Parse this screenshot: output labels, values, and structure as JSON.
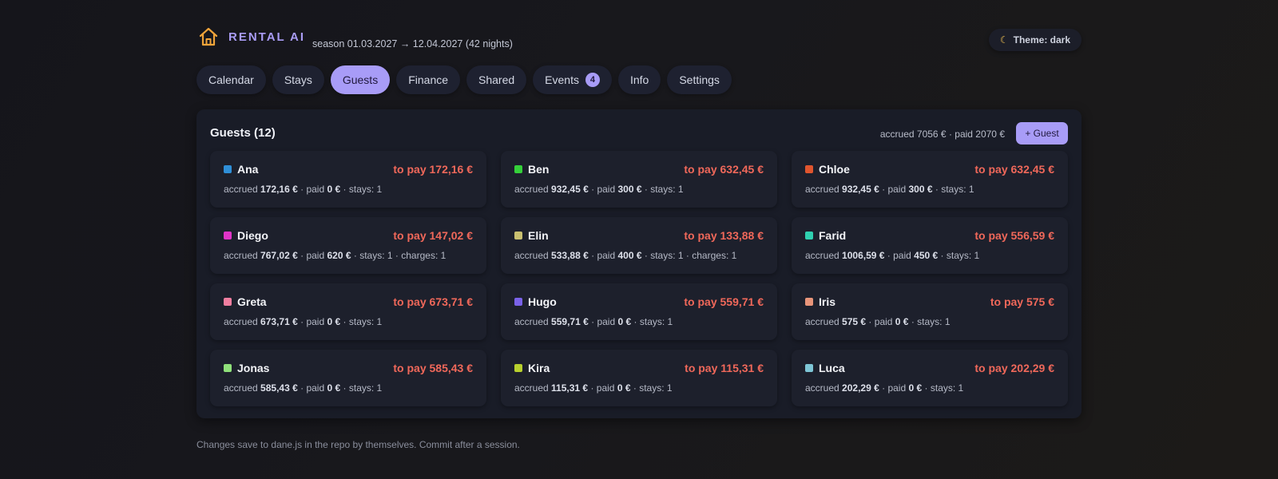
{
  "app": {
    "title": "RENTAL AI",
    "logo_icon": "home-icon",
    "accent_color": "#a89cf7",
    "season": "season 01.03.2027 → 12.04.2027 (42 nights)",
    "theme_label": "Theme: dark",
    "theme_icon": "moon-icon"
  },
  "tabs": [
    {
      "label": "Calendar"
    },
    {
      "label": "Stays"
    },
    {
      "label": "Guests",
      "active": true
    },
    {
      "label": "Finance"
    },
    {
      "label": "Shared"
    },
    {
      "label": "Events",
      "badge": "4"
    },
    {
      "label": "Info"
    },
    {
      "label": "Settings"
    }
  ],
  "guests_panel": {
    "title": "Guests (12)",
    "summary": "accrued 7056 € · paid 2070 €",
    "add_button_label": "+ Guest",
    "to_pay_color": "#f0685a",
    "guests": [
      {
        "name": "Ana",
        "color": "#2f8fd8",
        "to_pay": "to pay 172,16 €",
        "accrued": "172,16 €",
        "paid": "0 €",
        "stays": "stays: 1",
        "charges": ""
      },
      {
        "name": "Ben",
        "color": "#35d03a",
        "to_pay": "to pay 632,45 €",
        "accrued": "932,45 €",
        "paid": "300 €",
        "stays": "stays: 1",
        "charges": ""
      },
      {
        "name": "Chloe",
        "color": "#e0552e",
        "to_pay": "to pay 632,45 €",
        "accrued": "932,45 €",
        "paid": "300 €",
        "stays": "stays: 1",
        "charges": ""
      },
      {
        "name": "Diego",
        "color": "#e034c8",
        "to_pay": "to pay 147,02 €",
        "accrued": "767,02 €",
        "paid": "620 €",
        "stays": "stays: 1",
        "charges": "charges: 1"
      },
      {
        "name": "Elin",
        "color": "#c9c070",
        "to_pay": "to pay 133,88 €",
        "accrued": "533,88 €",
        "paid": "400 €",
        "stays": "stays: 1",
        "charges": "charges: 1"
      },
      {
        "name": "Farid",
        "color": "#2fd0b0",
        "to_pay": "to pay 556,59 €",
        "accrued": "1006,59 €",
        "paid": "450 €",
        "stays": "stays: 1",
        "charges": ""
      },
      {
        "name": "Greta",
        "color": "#f07ea0",
        "to_pay": "to pay 673,71 €",
        "accrued": "673,71 €",
        "paid": "0 €",
        "stays": "stays: 1",
        "charges": ""
      },
      {
        "name": "Hugo",
        "color": "#7a62e8",
        "to_pay": "to pay 559,71 €",
        "accrued": "559,71 €",
        "paid": "0 €",
        "stays": "stays: 1",
        "charges": ""
      },
      {
        "name": "Iris",
        "color": "#e8957a",
        "to_pay": "to pay 575 €",
        "accrued": "575 €",
        "paid": "0 €",
        "stays": "stays: 1",
        "charges": ""
      },
      {
        "name": "Jonas",
        "color": "#8fe07a",
        "to_pay": "to pay 585,43 €",
        "accrued": "585,43 €",
        "paid": "0 €",
        "stays": "stays: 1",
        "charges": ""
      },
      {
        "name": "Kira",
        "color": "#b8d02e",
        "to_pay": "to pay 115,31 €",
        "accrued": "115,31 €",
        "paid": "0 €",
        "stays": "stays: 1",
        "charges": ""
      },
      {
        "name": "Luca",
        "color": "#7ec6d6",
        "to_pay": "to pay 202,29 €",
        "accrued": "202,29 €",
        "paid": "0 €",
        "stays": "stays: 1",
        "charges": ""
      }
    ]
  },
  "labels": {
    "accrued": "accrued",
    "paid": "paid",
    "separator": "·"
  },
  "footer": "Changes save to dane.js in the repo by themselves. Commit after a session."
}
